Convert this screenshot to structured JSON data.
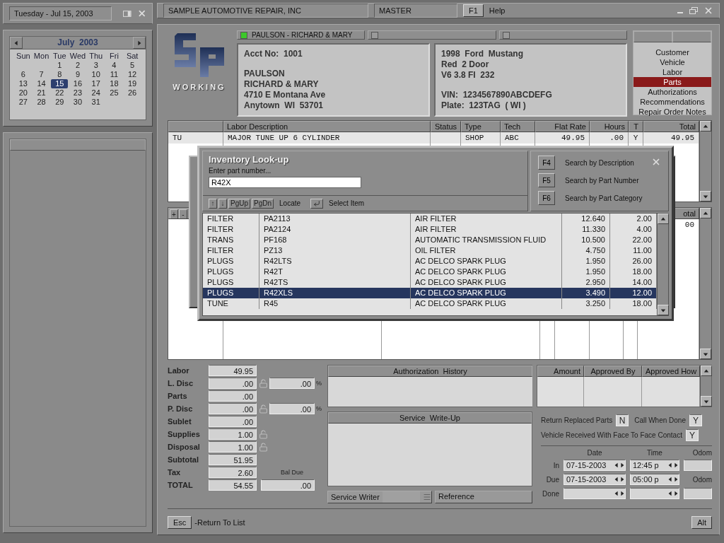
{
  "date_panel": {
    "title": "Tuesday - Jul 15, 2003"
  },
  "calendar": {
    "month": "July  2003",
    "weekdays": [
      "Sun",
      "Mon",
      "Tue",
      "Wed",
      "Thu",
      "Fri",
      "Sat"
    ],
    "weeks": [
      [
        {
          "label": "1",
          "selected": false
        },
        {
          "label": "2",
          "selected": false
        },
        {
          "label": "3",
          "selected": false
        },
        {
          "label": "4",
          "selected": false
        },
        {
          "label": "5",
          "selected": false
        }
      ],
      [
        {
          "label": "6",
          "selected": false
        },
        {
          "label": "7",
          "selected": false
        },
        {
          "label": "8",
          "selected": false
        },
        {
          "label": "9",
          "selected": false
        },
        {
          "label": "10",
          "selected": false
        },
        {
          "label": "11",
          "selected": false
        },
        {
          "label": "12",
          "selected": false
        }
      ],
      [
        {
          "label": "13",
          "selected": false
        },
        {
          "label": "14",
          "selected": false
        },
        {
          "label": "15",
          "selected": true
        },
        {
          "label": "16",
          "selected": false
        },
        {
          "label": "17",
          "selected": false
        },
        {
          "label": "18",
          "selected": false
        },
        {
          "label": "19",
          "selected": false
        }
      ],
      [
        {
          "label": "20",
          "selected": false
        },
        {
          "label": "21",
          "selected": false
        },
        {
          "label": "22",
          "selected": false
        },
        {
          "label": "23",
          "selected": false
        },
        {
          "label": "24",
          "selected": false
        },
        {
          "label": "25",
          "selected": false
        },
        {
          "label": "26",
          "selected": false
        }
      ],
      [
        {
          "label": "27",
          "selected": false
        },
        {
          "label": "28",
          "selected": false
        },
        {
          "label": "29",
          "selected": false
        },
        {
          "label": "30",
          "selected": false
        },
        {
          "label": "31",
          "selected": false
        }
      ]
    ]
  },
  "window": {
    "title": "SAMPLE AUTOMOTIVE REPAIR, INC",
    "mode": "MASTER",
    "help_key": "F1",
    "help_label": "Help"
  },
  "logo": {
    "caption": "WORKING"
  },
  "customer_tabs": [
    {
      "label": "PAULSON - RICHARD & MARY",
      "on": true
    },
    {
      "on": false
    },
    {
      "on": false
    }
  ],
  "customer": {
    "acct_label": "Acct No:",
    "acct": "1001",
    "lines": [
      "PAULSON",
      "RICHARD & MARY",
      "4710 E Montana Ave",
      "Anytown  WI  53701"
    ]
  },
  "vehicle": {
    "lines": [
      "1998  Ford  Mustang",
      "Red  2 Door",
      "V6 3.8 FI  232"
    ],
    "id_lines": [
      "VIN:  1234567890ABCDEFG",
      "Plate:  123TAG  ( WI )"
    ]
  },
  "nav": [
    {
      "label": "Customer",
      "selected": false
    },
    {
      "label": "Vehicle",
      "selected": false
    },
    {
      "label": "Labor",
      "selected": false
    },
    {
      "label": "Parts",
      "selected": true
    },
    {
      "label": "Authorizations",
      "selected": false
    },
    {
      "label": "Recommendations",
      "selected": false
    },
    {
      "label": "Repair Order Notes",
      "selected": false
    }
  ],
  "labor_table": {
    "columns": [
      "",
      "Labor Description",
      "Status",
      "Type",
      "Tech",
      "Flat Rate",
      "Hours",
      "T",
      "Total"
    ],
    "rows": [
      [
        "TU",
        "MAJOR TUNE UP 6 CYLINDER",
        null,
        "SHOP",
        "ABC",
        "49.95",
        ".00",
        "Y",
        "49.95"
      ]
    ]
  },
  "parts_table": {
    "add_key": "+",
    "remove_key": "-",
    "header_fragment": "otal",
    "cell_fragment": "00"
  },
  "lookup": {
    "title": "Inventory Look-up",
    "prompt": "Enter part number...",
    "value": "R42X",
    "nav_keys": [
      "↑",
      "↓",
      "PgUp",
      "PgDn"
    ],
    "locate_label": "Locate",
    "select_label": "Select Item",
    "search_options": [
      {
        "key": "F4",
        "label": "Search by Description"
      },
      {
        "key": "F5",
        "label": "Search by Part Number"
      },
      {
        "key": "F6",
        "label": "Search by Part Category"
      }
    ],
    "rows": [
      {
        "category": "FILTER",
        "part": "PA2113",
        "description": "AIR FILTER",
        "price": "12.640",
        "qty": "2.00",
        "selected": false
      },
      {
        "category": "FILTER",
        "part": "PA2124",
        "description": "AIR FILTER",
        "price": "11.330",
        "qty": "4.00",
        "selected": false
      },
      {
        "category": "TRANS",
        "part": "PF168",
        "description": "AUTOMATIC TRANSMISSION FLUID",
        "price": "10.500",
        "qty": "22.00",
        "selected": false
      },
      {
        "category": "FILTER",
        "part": "PZ13",
        "description": "OIL FILTER",
        "price": "4.750",
        "qty": "11.00",
        "selected": false
      },
      {
        "category": "PLUGS",
        "part": "R42LTS",
        "description": "AC DELCO SPARK PLUG",
        "price": "1.950",
        "qty": "26.00",
        "selected": false
      },
      {
        "category": "PLUGS",
        "part": "R42T",
        "description": "AC DELCO SPARK PLUG",
        "price": "1.950",
        "qty": "18.00",
        "selected": false
      },
      {
        "category": "PLUGS",
        "part": "R42TS",
        "description": "AC DELCO SPARK PLUG",
        "price": "2.950",
        "qty": "14.00",
        "selected": false
      },
      {
        "category": "PLUGS",
        "part": "R42XLS",
        "description": "AC DELCO SPARK PLUG",
        "price": "3.490",
        "qty": "12.00",
        "selected": true
      },
      {
        "category": "TUNE",
        "part": "R45",
        "description": "AC DELCO SPARK PLUG",
        "price": "3.250",
        "qty": "18.00",
        "selected": false
      }
    ]
  },
  "totals": [
    {
      "label": "Labor",
      "value": "49.95"
    },
    {
      "label": "L. Disc",
      "value": ".00",
      "lock": true,
      "percent": ".00",
      "percent_sign": "%"
    },
    {
      "label": "Parts",
      "value": ".00"
    },
    {
      "label": "P. Disc",
      "value": ".00",
      "lock": true,
      "percent": ".00",
      "percent_sign": "%"
    },
    {
      "label": "Sublet",
      "value": ".00"
    },
    {
      "label": "Supplies",
      "value": "1.00",
      "lock": true
    },
    {
      "label": "Disposal",
      "value": "1.00",
      "lock": true
    },
    {
      "label": "Subtotal",
      "value": "51.95"
    },
    {
      "label": "Tax",
      "value": "2.60",
      "side_label": "Bal Due"
    },
    {
      "label": "TOTAL",
      "value": "54.55",
      "side_value": ".00"
    }
  ],
  "authorization": {
    "columns": [
      "Authorization  History",
      "Amount",
      "Approved By",
      "Approved How"
    ]
  },
  "service_writeup": {
    "title": "Service  Write-Up",
    "writer_label": "Service Writer",
    "reference_label": "Reference"
  },
  "flags": [
    {
      "label": "Return Replaced Parts",
      "value": "N"
    },
    {
      "label": "Call When Done",
      "value": "Y"
    },
    {
      "label": "Vehicle Received With Face To Face Contact",
      "value": "Y"
    }
  ],
  "schedule": {
    "date_header": "Date",
    "time_header": "Time",
    "odom_header": "Odom",
    "rows": [
      {
        "label": "In",
        "date": "07-15-2003",
        "time": "12:45 p"
      },
      {
        "label": "Due",
        "date": "07-15-2003",
        "time": "05:00 p",
        "odom_label": "Odom"
      },
      {
        "label": "Done"
      }
    ]
  },
  "footer": {
    "esc_key": "Esc",
    "esc_label": "-Return To List",
    "alt_key": "Alt"
  }
}
